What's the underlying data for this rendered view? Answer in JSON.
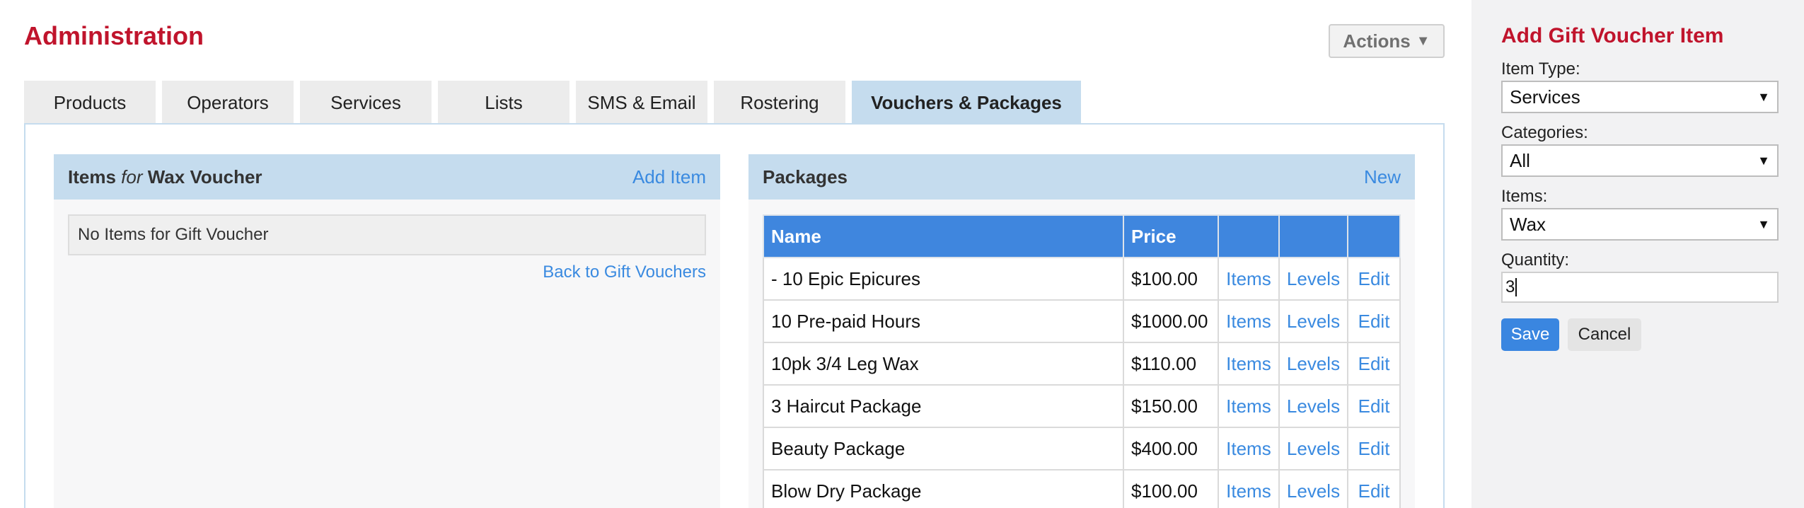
{
  "header": {
    "title": "Administration",
    "actions_label": "Actions",
    "actions_icon": "triangle-down-icon"
  },
  "tabs": [
    {
      "label": "Products"
    },
    {
      "label": "Operators"
    },
    {
      "label": "Services"
    },
    {
      "label": "Lists"
    },
    {
      "label": "SMS & Email"
    },
    {
      "label": "Rostering"
    },
    {
      "label": "Vouchers & Packages",
      "active": true
    }
  ],
  "items_panel": {
    "title_prefix": "Items",
    "title_for": "for",
    "title_name": "Wax Voucher",
    "add_label": "Add Item",
    "empty_text": "No Items for Gift Voucher",
    "back_label": "Back to Gift Vouchers"
  },
  "packages_panel": {
    "title": "Packages",
    "new_label": "New",
    "columns": [
      "Name",
      "Price",
      "",
      "",
      ""
    ],
    "rows": [
      {
        "name": "- 10 Epic Epicures",
        "price": "$100.00",
        "items": "Items",
        "levels": "Levels",
        "edit": "Edit"
      },
      {
        "name": "10 Pre-paid Hours",
        "price": "$1000.00",
        "items": "Items",
        "levels": "Levels",
        "edit": "Edit"
      },
      {
        "name": "10pk 3/4 Leg Wax",
        "price": "$110.00",
        "items": "Items",
        "levels": "Levels",
        "edit": "Edit"
      },
      {
        "name": "3 Haircut Package",
        "price": "$150.00",
        "items": "Items",
        "levels": "Levels",
        "edit": "Edit"
      },
      {
        "name": "Beauty Package",
        "price": "$400.00",
        "items": "Items",
        "levels": "Levels",
        "edit": "Edit"
      },
      {
        "name": "Blow Dry Package",
        "price": "$100.00",
        "items": "Items",
        "levels": "Levels",
        "edit": "Edit"
      }
    ]
  },
  "form": {
    "title": "Add Gift Voucher Item",
    "item_type_label": "Item Type:",
    "item_type_value": "Services",
    "categories_label": "Categories:",
    "categories_value": "All",
    "items_label": "Items:",
    "items_value": "Wax",
    "quantity_label": "Quantity:",
    "quantity_value": "3",
    "save_label": "Save",
    "cancel_label": "Cancel"
  },
  "colors": {
    "brand": "#c0142c",
    "accent": "#3a86e0",
    "tab_active": "#c5dcee"
  }
}
